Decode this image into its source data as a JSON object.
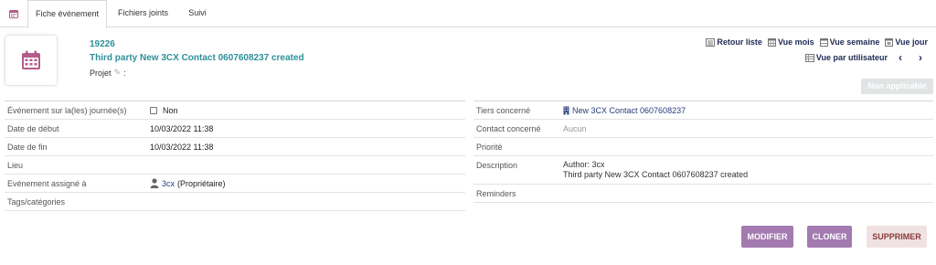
{
  "tabs": [
    {
      "label": "Fiche événement",
      "active": true
    },
    {
      "label": "Fichiers joints",
      "active": false
    },
    {
      "label": "Suivi",
      "active": false
    }
  ],
  "header": {
    "ref": "19226",
    "title": "Third party New 3CX Contact 0607608237 created",
    "projet_label": "Projet",
    "projet_suffix": ":"
  },
  "nav": {
    "retour_liste": "Retour liste",
    "vue_mois": "Vue mois",
    "vue_semaine": "Vue semaine",
    "vue_jour": "Vue jour",
    "vue_par_utilisateur": "Vue par utilisateur",
    "prev": "‹",
    "next": "›"
  },
  "status_badge": "Non applicable",
  "left_fields": [
    {
      "label": "Événement sur la(les) journée(s)",
      "value": "Non"
    },
    {
      "label": "Date de début",
      "value": "10/03/2022 11:38"
    },
    {
      "label": "Date de fin",
      "value": "10/03/2022 11:38"
    },
    {
      "label": "Lieu",
      "value": ""
    },
    {
      "label": "Evénement assigné à",
      "value_link": "3cx",
      "value_suffix": "(Propriétaire)"
    },
    {
      "label": "Tags/catégories",
      "value": ""
    }
  ],
  "right_fields": [
    {
      "label": "Tiers concerné",
      "value": "New 3CX Contact 0607608237"
    },
    {
      "label": "Contact concerné",
      "value": "Aucun"
    },
    {
      "label": "Priorité",
      "value": ""
    },
    {
      "label": "Description",
      "line1": "Author: 3cx",
      "line2": "Third party New 3CX Contact 0607608237 created"
    },
    {
      "label": "Reminders",
      "value": ""
    }
  ],
  "buttons": {
    "modifier": "MODIFIER",
    "cloner": "CLONER",
    "supprimer": "SUPPRIMER"
  },
  "colors": {
    "accent_title": "#2e8f99",
    "nav_link": "#1d2a55",
    "button_primary": "#a37bb0",
    "button_delete_bg": "#f0e2e2",
    "calendar_icon": "#b25c8a"
  }
}
